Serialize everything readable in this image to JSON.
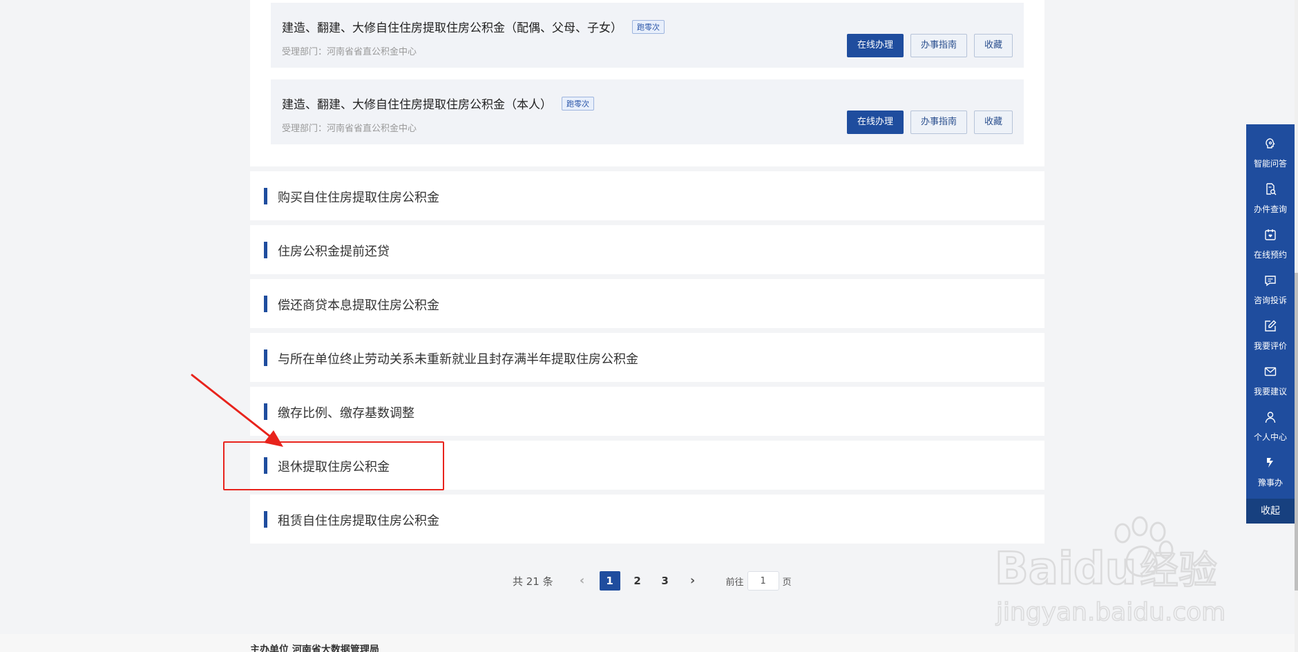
{
  "panel": {
    "items": [
      {
        "title": "建造、翻建、大修自住住房提取住房公积金（配偶、父母、子女）",
        "tag": "跑零次",
        "dept": "受理部门：河南省省直公积金中心",
        "buttons": {
          "online": "在线办理",
          "guide": "办事指南",
          "fav": "收藏"
        }
      },
      {
        "title": "建造、翻建、大修自住住房提取住房公积金（本人）",
        "tag": "跑零次",
        "dept": "受理部门：河南省省直公积金中心",
        "buttons": {
          "online": "在线办理",
          "guide": "办事指南",
          "fav": "收藏"
        }
      }
    ]
  },
  "categories": [
    "购买自住住房提取住房公积金",
    "住房公积金提前还贷",
    "偿还商贷本息提取住房公积金",
    "与所在单位终止劳动关系未重新就业且封存满半年提取住房公积金",
    "缴存比例、缴存基数调整",
    "退休提取住房公积金",
    "租赁自住住房提取住房公积金"
  ],
  "pagination": {
    "total": "共 21 条",
    "prev": "‹",
    "pages": [
      "1",
      "2",
      "3"
    ],
    "next": "›",
    "goto_label": "前往",
    "goto_value": "1",
    "page_unit": "页"
  },
  "footer": {
    "host": "主办单位  河南省大数据管理局"
  },
  "sidebar": {
    "items": [
      {
        "label": "智能问答",
        "icon": "brain-icon"
      },
      {
        "label": "办件查询",
        "icon": "document-search-icon"
      },
      {
        "label": "在线预约",
        "icon": "calendar-icon"
      },
      {
        "label": "咨询投诉",
        "icon": "chat-icon"
      },
      {
        "label": "我要评价",
        "icon": "edit-icon"
      },
      {
        "label": "我要建议",
        "icon": "mail-icon"
      },
      {
        "label": "个人中心",
        "icon": "user-icon"
      },
      {
        "label": "豫事办",
        "icon": "brand-icon"
      }
    ],
    "collapse": "收起"
  },
  "colors": {
    "accent": "#1f4d9e",
    "highlight": "#e8231c",
    "arrow": "#e8231c"
  },
  "watermark": {
    "brand": "Baidu",
    "brand_cn": "经验",
    "url": "jingyan.baidu.com"
  }
}
